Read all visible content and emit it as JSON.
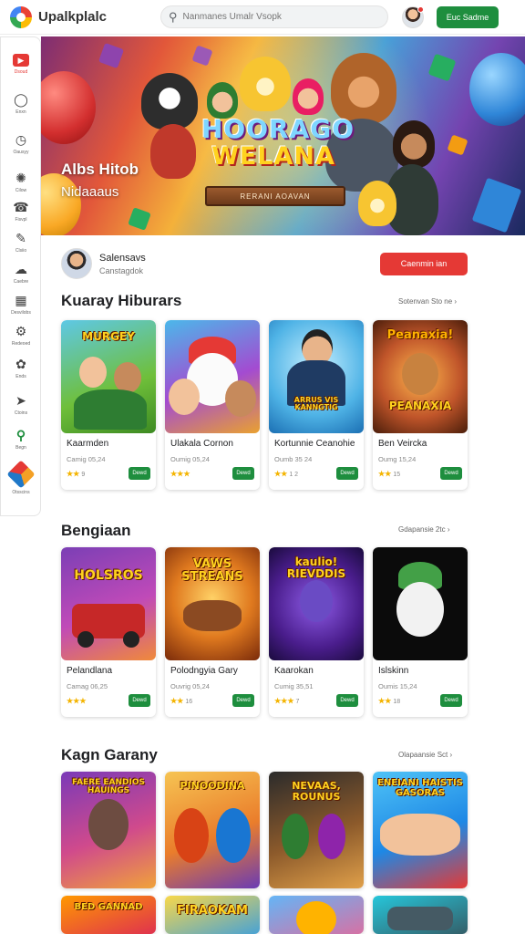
{
  "app": {
    "title": "Upalkplalc"
  },
  "search": {
    "placeholder": "Nanmanes Umalr Vsopk"
  },
  "header": {
    "cta_label": "Euc Sadme"
  },
  "sidebar": {
    "items": [
      {
        "label": "Dsoud",
        "icon": "home-icon"
      },
      {
        "label": "Enxn",
        "icon": "chat-bubble-icon"
      },
      {
        "label": "Oausyy",
        "icon": "clock-icon"
      },
      {
        "label": "Cilow",
        "icon": "puzzle-icon"
      },
      {
        "label": "Fisvpl",
        "icon": "bell-icon"
      },
      {
        "label": "Clsiio",
        "icon": "pen-icon"
      },
      {
        "label": "Caebre",
        "icon": "cloud-icon"
      },
      {
        "label": "Desvilobs",
        "icon": "calendar-icon"
      },
      {
        "label": "Redeoed",
        "icon": "settings-icon"
      },
      {
        "label": "Ends",
        "icon": "brain-icon"
      },
      {
        "label": "Ctoins",
        "icon": "tag-icon"
      },
      {
        "label": "Begn",
        "icon": "search-icon"
      },
      {
        "label": "Otsscins",
        "icon": "cube-icon"
      }
    ]
  },
  "hero": {
    "title": "Albs Hitob",
    "subtitle": "Nidaaaus",
    "sign_line1": "HOORAGO",
    "sign_line2": "WELANA",
    "plank_text": "RERANI AOAVAN"
  },
  "channel": {
    "name": "Salensavs",
    "sub": "Canstagdok",
    "button": "Caenmin ian"
  },
  "sections": [
    {
      "title": "Kuaray Hiburars",
      "more": "Sotenvan Sto ne",
      "cards": [
        {
          "name": "Kaarmden",
          "meta": "Camig 05,24",
          "stars": "★★",
          "rating": "9",
          "btn": "Dewd",
          "thumb_title": "MURGEY"
        },
        {
          "name": "Ulakala Cornon",
          "meta": "Oumig 05,24",
          "stars": "★★★",
          "rating": "",
          "btn": "Dewd",
          "thumb_title": ""
        },
        {
          "name": "Kortunnie Ceanohie",
          "meta": "Oumb 35 24",
          "stars": "★★",
          "rating": "1 2",
          "btn": "Dewd",
          "thumb_title": "ARRUS VIS KANNGTIG"
        },
        {
          "name": "Ben Veircka",
          "meta": "Oumg 15,24",
          "stars": "★★",
          "rating": "15",
          "btn": "Dewd",
          "thumb_title": "PEANAXIA"
        }
      ]
    },
    {
      "title": "Bengiaan",
      "more": "Gdapansie 2tc",
      "cards": [
        {
          "name": "Pelandlana",
          "meta": "Camag 06,25",
          "stars": "★★★",
          "rating": "",
          "btn": "Dewd",
          "thumb_title": "HOLSROS"
        },
        {
          "name": "Polodngyia Gary",
          "meta": "Ouvrig 05,24",
          "stars": "★★",
          "rating": "16",
          "btn": "Dewd",
          "thumb_title": "VAWS STREANS"
        },
        {
          "name": "Kaarokan",
          "meta": "Cumig 35,51",
          "stars": "★★★",
          "rating": "7",
          "btn": "Dewd",
          "thumb_title": "kaulio! RIEVDDIS"
        },
        {
          "name": "Islskinn",
          "meta": "Oumis 15,24",
          "stars": "★★",
          "rating": "18",
          "btn": "Dewd",
          "thumb_title": ""
        }
      ]
    },
    {
      "title": "Kagn Garany",
      "more": "Olapaansie Sct",
      "cards": [
        {
          "thumb_title": "FAERE EANDIOS HAUINGS"
        },
        {
          "thumb_title": "PINOODINA"
        },
        {
          "thumb_title": "NEVAAS, ROUNUS"
        },
        {
          "thumb_title": "ENEIANI HAISTIS GASORAS"
        }
      ]
    },
    {
      "cards": [
        {
          "thumb_title": "BED GANNAD"
        },
        {
          "thumb_title": "FIRAOKAM"
        },
        {
          "thumb_title": ""
        },
        {
          "thumb_title": ""
        }
      ]
    }
  ],
  "colors": {
    "accent_green": "#1e8e3e",
    "accent_red": "#e53935",
    "star_yellow": "#f4b400"
  }
}
